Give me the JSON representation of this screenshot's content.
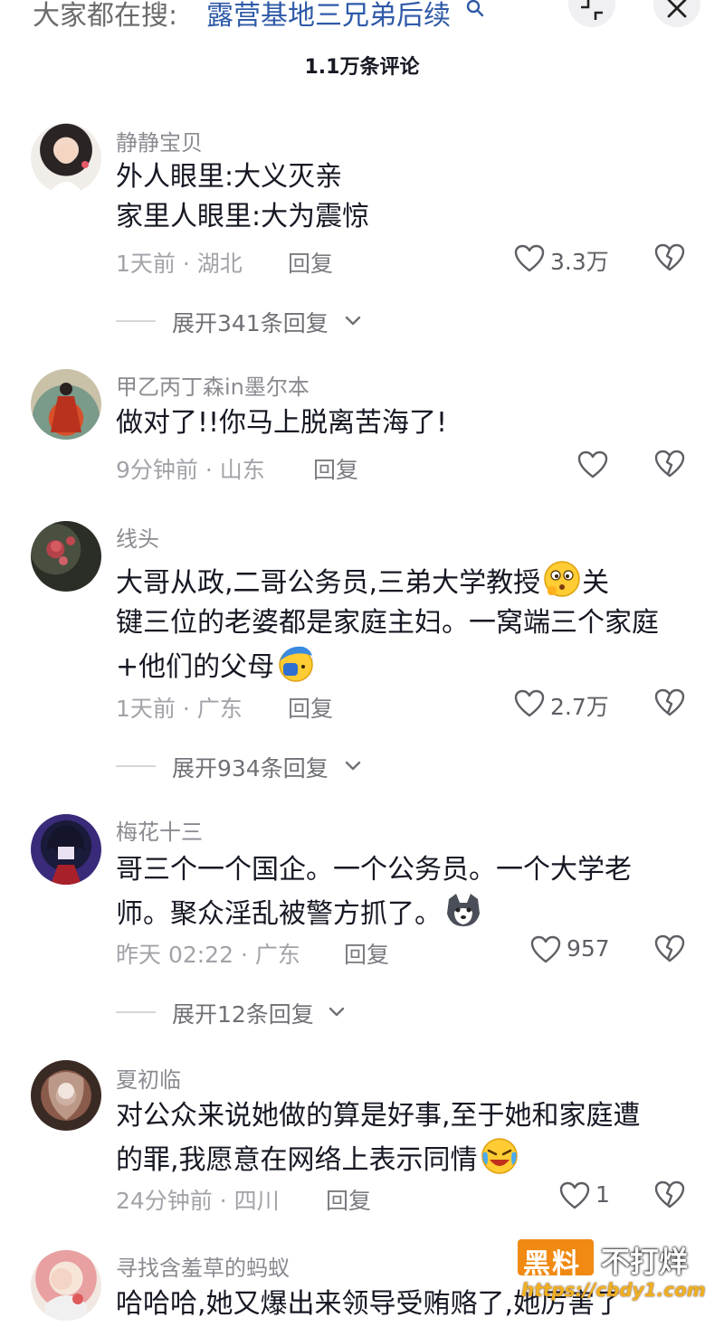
{
  "header": {
    "search_prefix": "大家都在搜:",
    "search_term": "露营基地三兄弟后续",
    "comment_count": "1.1万条评论"
  },
  "comments": [
    {
      "username": "静静宝贝",
      "lines": [
        "外人眼里:大义灭亲",
        "家里人眼里:大为震惊"
      ],
      "time": "1天前",
      "location": "湖北",
      "reply_label": "回复",
      "likes": "3.3万",
      "expand_label": "展开341条回复"
    },
    {
      "username": "甲乙丙丁森in墨尔本",
      "lines": [
        "做对了!!你马上脱离苦海了!"
      ],
      "time": "9分钟前",
      "location": "山东",
      "reply_label": "回复",
      "likes": ""
    },
    {
      "username": "线头",
      "lines": [
        "大哥从政,二哥公务员,三弟大学教授",
        "键三位的老婆都是家庭主妇。一窝端三个家庭",
        "+他们的父母"
      ],
      "line_suffix_1": "关",
      "time": "1天前",
      "location": "广东",
      "reply_label": "回复",
      "likes": "2.7万",
      "expand_label": "展开934条回复"
    },
    {
      "username": "梅花十三",
      "lines": [
        "哥三个一个国企。一个公务员。一个大学老",
        "师。聚众淫乱被警方抓了。"
      ],
      "time": "昨天 02:22",
      "location": "广东",
      "reply_label": "回复",
      "likes": "957",
      "expand_label": "展开12条回复"
    },
    {
      "username": "夏初临",
      "lines": [
        "对公众来说她做的算是好事,至于她和家庭遭",
        "的罪,我愿意在网络上表示同情"
      ],
      "time": "24分钟前",
      "location": "四川",
      "reply_label": "回复",
      "likes": "1"
    },
    {
      "username": "寻找含羞草的蚂蚁",
      "lines": [
        "哈哈哈,她又爆出来领导受贿赂了,她厉害了"
      ]
    }
  ],
  "watermark": {
    "brand_box": "黑料",
    "brand_text": "不打烊",
    "url": "https://cbdy1.com"
  },
  "colors": {
    "link": "#2f5aa8",
    "text": "#161823",
    "meta": "#a2a3a8",
    "watermark": "#f08a12"
  },
  "icons": [
    "search-icon",
    "shrink-icon",
    "close-icon",
    "heart-icon",
    "broken-heart-icon",
    "chevron-down-icon"
  ]
}
